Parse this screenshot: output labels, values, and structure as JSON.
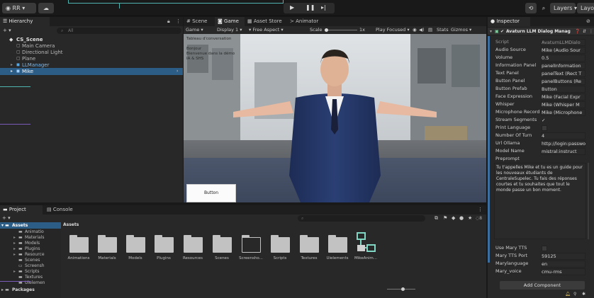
{
  "toolbar": {
    "account": "RR",
    "play_icon": "play-icon",
    "pause_icon": "pause-icon",
    "step_icon": "step-icon",
    "layers": "Layers",
    "layout": "Layout"
  },
  "hierarchy": {
    "tab": "Hierarchy",
    "search_placeholder": "All",
    "items": [
      {
        "label": "CS_Scene"
      },
      {
        "label": "Main Camera"
      },
      {
        "label": "Directional Light"
      },
      {
        "label": "Plane"
      },
      {
        "label": "LLManager"
      },
      {
        "label": "Mike"
      }
    ]
  },
  "scene_tabs": {
    "scene": "Scene",
    "game": "Game",
    "asset_store": "Asset Store",
    "animator": "Animator"
  },
  "game_toolbar": {
    "game_dropdown": "Game",
    "display": "Display 1",
    "aspect": "Free Aspect",
    "scale_label": "Scale",
    "scale_value": "1x",
    "play_focused": "Play Focused",
    "stats": "Stats",
    "gizmos": "Gizmos"
  },
  "game_view": {
    "conversation": "Tableau d'conversation\n\nBonjour\nBienvenue dans la démo\nIA & SHS",
    "button_label": "Button"
  },
  "project": {
    "project_tab": "Project",
    "console_tab": "Console",
    "tree": [
      {
        "label": "Assets"
      },
      {
        "label": "Animatio"
      },
      {
        "label": "Materials"
      },
      {
        "label": "Models"
      },
      {
        "label": "Plugins"
      },
      {
        "label": "Resource"
      },
      {
        "label": "Scenes"
      },
      {
        "label": "Screensh"
      },
      {
        "label": "Scripts"
      },
      {
        "label": "Textures"
      },
      {
        "label": "Uielemen"
      },
      {
        "label": "Packages"
      }
    ],
    "breadcrumb": "Assets",
    "assets": [
      {
        "label": "Animations"
      },
      {
        "label": "Materials"
      },
      {
        "label": "Models"
      },
      {
        "label": "Plugins"
      },
      {
        "label": "Resources"
      },
      {
        "label": "Scenes"
      },
      {
        "label": "Screensho..."
      },
      {
        "label": "Scripts"
      },
      {
        "label": "Textures"
      },
      {
        "label": "Uielements"
      },
      {
        "label": "MikeAnim..."
      }
    ],
    "badge_count": "8"
  },
  "inspector": {
    "tab": "Inspector",
    "component_title": "Avaturn LLM Dialog Manag",
    "fields": [
      {
        "label": "Script",
        "value": "AvaturnLLMDialo"
      },
      {
        "label": "Audio Source",
        "value": "Mike (Audio Sour"
      },
      {
        "label": "Volume",
        "value": "0.5"
      },
      {
        "label": "Information Panel",
        "value": "panelInformation"
      },
      {
        "label": "Text Panel",
        "value": "panelText (Rect T"
      },
      {
        "label": "Button Panel",
        "value": "panelButtons (Re"
      },
      {
        "label": "Button Prefab",
        "value": "Button"
      },
      {
        "label": "Face Expression",
        "value": "Mike (Facial Expr"
      },
      {
        "label": "Whisper",
        "value": "Mike (Whisper M"
      },
      {
        "label": "Microphone Record",
        "value": "Mike (Microphone"
      },
      {
        "label": "Stream Segments",
        "value": "✓"
      },
      {
        "label": "Print Language",
        "value": ""
      },
      {
        "label": "Number Of Turn",
        "value": "4"
      },
      {
        "label": "Url Ollama",
        "value": "http://login:password"
      },
      {
        "label": "Model Name",
        "value": "mistral:instruct"
      },
      {
        "label": "Preprompt",
        "value": ""
      }
    ],
    "preprompt_text": "Tu t'appelles Mike et tu es un guide pour les nouveaux étudiants de CentraleSupelec. Tu fais des réponses courtes et tu souhaites que tout le monde passe un bon moment.",
    "mary_fields": [
      {
        "label": "Use Mary TTS",
        "value": ""
      },
      {
        "label": "Mary TTS Port",
        "value": "59125"
      },
      {
        "label": "Marylanguage",
        "value": "en"
      },
      {
        "label": "Mary_voice",
        "value": "cmu-rms"
      }
    ],
    "add_component": "Add Component"
  }
}
